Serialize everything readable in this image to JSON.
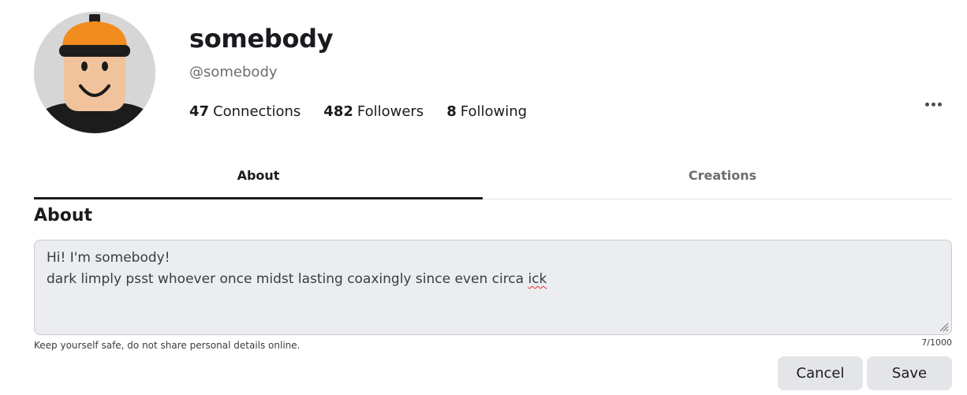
{
  "profile": {
    "display_name": "somebody",
    "handle": "@somebody",
    "stats": [
      {
        "count": "47",
        "label": "Connections"
      },
      {
        "count": "482",
        "label": "Followers"
      },
      {
        "count": "8",
        "label": "Following"
      }
    ]
  },
  "tabs": [
    {
      "label": "About",
      "active": true
    },
    {
      "label": "Creations",
      "active": false
    }
  ],
  "about": {
    "heading": "About",
    "text_line_1": "Hi! I'm somebody!",
    "text_line_2_main": "dark limply psst whoever once midst lasting coaxingly since even circa ",
    "text_line_2_misspelled": "ick",
    "safety_note": "Keep yourself safe, do not share personal details online.",
    "char_count": "7/1000"
  },
  "actions": {
    "cancel_label": "Cancel",
    "save_label": "Save"
  },
  "icons": {
    "more": "more-horizontal-icon",
    "resize": "resize-grip-icon"
  },
  "colors": {
    "text_primary": "#1a1b1f",
    "text_secondary": "#6b6d73",
    "button_bg": "#e4e5e9",
    "textarea_bg": "#ebedf0",
    "avatar_hat": "#f28c1e",
    "spell_error": "#e0342c"
  }
}
